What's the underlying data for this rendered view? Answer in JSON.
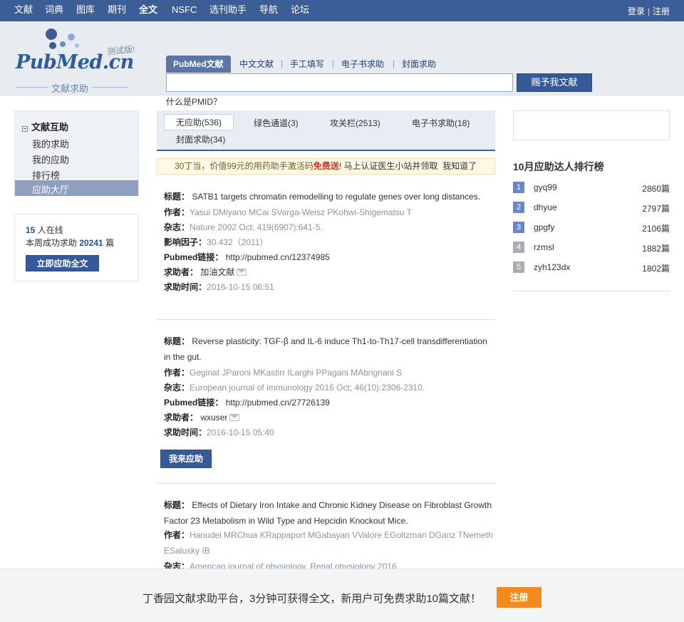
{
  "topnav": {
    "items": [
      "文献",
      "词典",
      "图库",
      "期刊",
      "全文",
      "NSFC",
      "选刊助手",
      "导航",
      "论坛"
    ],
    "login": "登录",
    "register": "注册"
  },
  "logo": {
    "brand": "PubMed",
    "suffix": ".cn",
    "beta": "测试版!",
    "subtitle": "文献求助"
  },
  "search": {
    "tabs": [
      "PubMed文献",
      "中文文献",
      "手工填写",
      "电子书求助",
      "封面求助"
    ],
    "button": "赐予我文献",
    "help": "什么是PMID？",
    "value": ""
  },
  "sidebar": {
    "title": "文献互助",
    "items": [
      "我的求助",
      "我的应助",
      "排行榜",
      "应助大厅"
    ],
    "online_count": "15",
    "online_label": "人在线",
    "week_label": "本周成功求助",
    "week_count": "20241",
    "week_unit": "篇",
    "button": "立即应助全文"
  },
  "main": {
    "tabs": [
      "无应助(536)",
      "绿色通道(3)",
      "攻关栏(2513)",
      "电子书求助(18)",
      "封面求助(34)"
    ],
    "notice": {
      "pre": "30丁当，价值99元的用药助手激活码",
      "free": "免费送",
      "mid": "! 马上认证医生小站并领取",
      "dismiss": "我知道了"
    },
    "labels": {
      "title": "标题：",
      "author": "作者：",
      "journal": "杂志：",
      "impact": "影响因子：",
      "link": "Pubmed链接：",
      "requester": "求助者：",
      "time": "求助时间："
    },
    "help_button": "我来应助",
    "entries": [
      {
        "title": "SATB1 targets chromatin remodelling to regulate genes over long distances.",
        "authors": "Yasui DMiyano MCai SVarga-Weisz PKohwi-Shigematsu T",
        "journal": "Nature 2002 Oct; 419(6907):641-5.",
        "impact": "30.432（2011）",
        "link": "http://pubmed.cn/12374985",
        "requester": "加油文献",
        "time": "2016-10-15 06:51"
      },
      {
        "title": "Reverse plasticity: TGF-β and IL-6 induce Th1-to-Th17-cell transdifferentiation in the gut.",
        "authors": "Geginat JParoni MKastirr ILarghi PPagani MAbrignani S",
        "journal": "European journal of immunology 2016 Oct; 46(10):2306-2310.",
        "link": "http://pubmed.cn/27726139",
        "requester": "wxuser",
        "time": "2016-10-15 05:40"
      },
      {
        "title": "Effects of Dietary Iron Intake and Chronic Kidney Disease on Fibroblast Growth Factor 23 Metabolism in Wild Type and Hepcidin Knockout Mice.",
        "authors": "Hanudel MRChua KRappaport MGabayan VValore EGoltzman DGanz TNemeth ESalusky IB",
        "journal": "American journal of physiology. Renal physiology 2016"
      }
    ]
  },
  "ranking": {
    "title": "10月应助达人排行榜",
    "rows": [
      {
        "rank": "1",
        "name": "gyq99",
        "count": "2860篇"
      },
      {
        "rank": "2",
        "name": "dhyue",
        "count": "2797篇"
      },
      {
        "rank": "3",
        "name": "gpgfy",
        "count": "2106篇"
      },
      {
        "rank": "4",
        "name": "rzmsl",
        "count": "1882篇"
      },
      {
        "rank": "5",
        "name": "zyh123dx",
        "count": "1802篇"
      }
    ],
    "colors": {
      "top": "#6a86c7",
      "other": "#a9acb1"
    }
  },
  "banner": {
    "text": "丁香园文献求助平台，3分钟可获得全文，新用户可免费求助10篇文献！",
    "button": "注册"
  }
}
